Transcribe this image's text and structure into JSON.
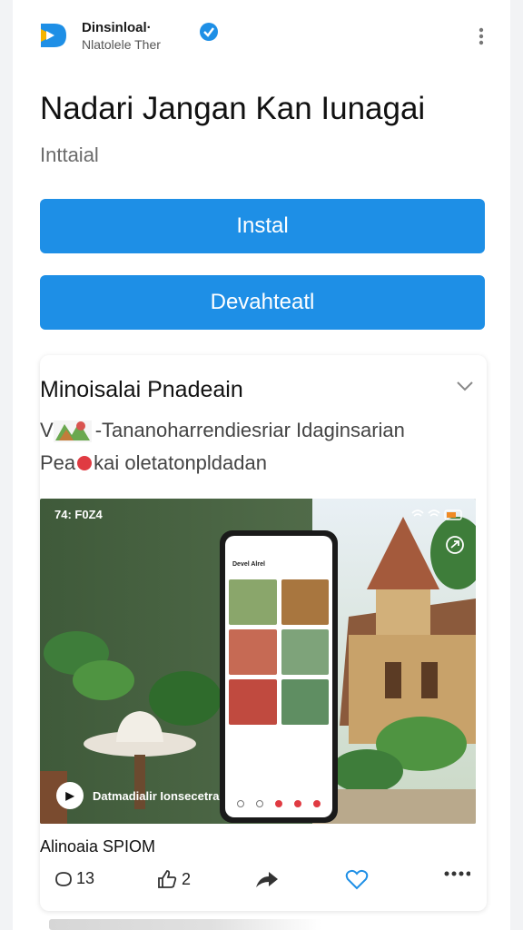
{
  "app": {
    "name": "Dinsinloal·",
    "subtitle": "Nlatolele Ther",
    "logo_icon": "app-logo-icon",
    "verified_icon": "verified-badge-icon",
    "menu_icon": "vertical-dots-icon"
  },
  "main": {
    "title": "Nadari Jangan Kan Iunagai",
    "subtitle": "Inttaial",
    "install_label": "Instal",
    "download_label": "Devahteatl"
  },
  "post": {
    "title": "Minoisalai Pnadeain",
    "line1": "-Tananoharrendiesriar Idaginsarian",
    "line2_prefix": "Pea",
    "line2_suffix": "kai oletatonpldadan",
    "media": {
      "time": "74: F0Z4",
      "caption": "Datmadialir Ionsecetra",
      "phone_header": "Devel Alrel"
    },
    "footer_label": "Alinoaia SPIOM",
    "actions": {
      "comments": "13",
      "likes": "2"
    }
  },
  "colors": {
    "accent": "#1e8fe6",
    "badge": "#e03b42"
  }
}
